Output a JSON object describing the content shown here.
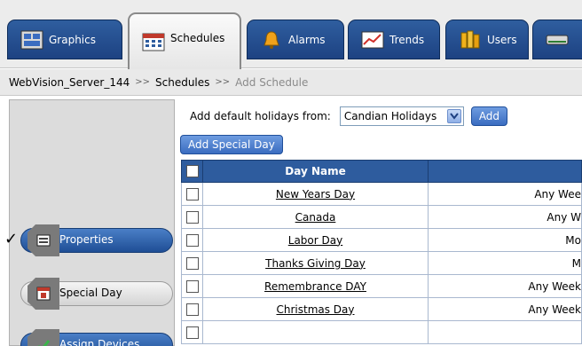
{
  "tabs": [
    {
      "label": "Graphics",
      "icon": "graphics-icon"
    },
    {
      "label": "Schedules",
      "icon": "calendar-icon",
      "active": true
    },
    {
      "label": "Alarms",
      "icon": "bell-icon"
    },
    {
      "label": "Trends",
      "icon": "trend-chart-icon"
    },
    {
      "label": "Users",
      "icon": "users-icon"
    },
    {
      "label": "",
      "icon": "server-icon"
    }
  ],
  "breadcrumb": {
    "server": "WebVision_Server_144",
    "separator": ">>",
    "section": "Schedules",
    "current": "Add Schedule"
  },
  "sidebar": {
    "items": [
      {
        "label": "Properties",
        "icon": "properties-icon",
        "active": true,
        "checked": true
      },
      {
        "label": "Special Day",
        "icon": "special-day-icon",
        "active": false
      },
      {
        "label": "Assign Devices",
        "icon": "assign-devices-icon",
        "active": true
      }
    ]
  },
  "holidays": {
    "label": "Add default holidays from:",
    "selected": "Candian Holidays",
    "add_button": "Add"
  },
  "special_day_button": "Add Special Day",
  "table": {
    "header": "Day Name",
    "rows": [
      {
        "name": "New Years Day",
        "day": "Any Wee"
      },
      {
        "name": "Canada",
        "day": "Any W"
      },
      {
        "name": "Labor Day",
        "day": "Mo"
      },
      {
        "name": "Thanks Giving Day",
        "day": "M"
      },
      {
        "name": "Remembrance DAY",
        "day": "Any Week"
      },
      {
        "name": "Christmas Day",
        "day": "Any Week"
      }
    ]
  },
  "colors": {
    "tab_blue": "#1d4282",
    "header_blue": "#2e5c9e",
    "button_blue": "#3a6cc0"
  }
}
